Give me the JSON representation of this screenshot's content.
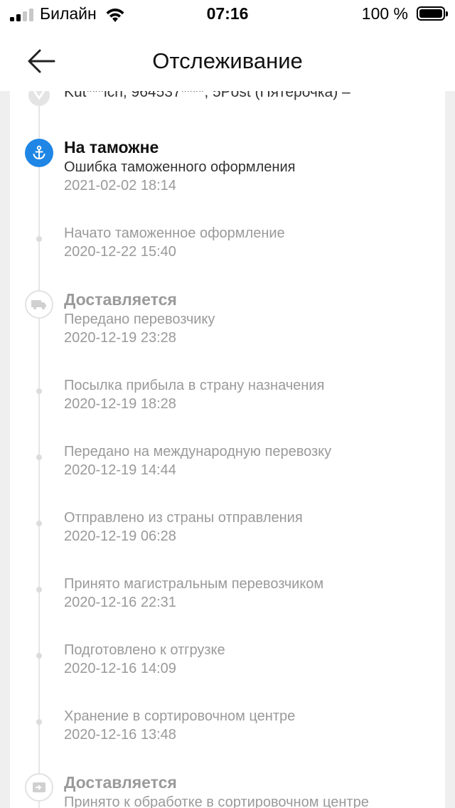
{
  "status_bar": {
    "carrier": "Билайн",
    "time": "07:16",
    "battery": "100 %"
  },
  "nav": {
    "title": "Отслеживание",
    "back_icon": "arrow-left-icon"
  },
  "address_row": {
    "text": "Kut***ich,  964537****,  5Post (Пятерочка) –",
    "icon": "location-pin-icon"
  },
  "colors": {
    "accent": "#1f86e6",
    "text_primary": "#111111",
    "text_muted": "#9a9a9a",
    "background": "#efefef"
  },
  "timeline": [
    {
      "status": "На таможне",
      "desc": "Ошибка таможенного оформления",
      "time": "2021-02-02 18:14",
      "icon": "anchor-icon"
    },
    {
      "status": "",
      "desc": "Начато таможенное оформление",
      "time": "2020-12-22 15:40",
      "icon": ""
    },
    {
      "status": "Доставляется",
      "desc": "Передано перевозчику",
      "time": "2020-12-19 23:28",
      "icon": "truck-icon"
    },
    {
      "status": "",
      "desc": "Посылка прибыла в страну назначения",
      "time": "2020-12-19 18:28",
      "icon": ""
    },
    {
      "status": "",
      "desc": "Передано на международную перевозку",
      "time": "2020-12-19 14:44",
      "icon": ""
    },
    {
      "status": "",
      "desc": "Отправлено из страны отправления",
      "time": "2020-12-19 06:28",
      "icon": ""
    },
    {
      "status": "",
      "desc": "Принято магистральным перевозчиком",
      "time": "2020-12-16 22:31",
      "icon": ""
    },
    {
      "status": "",
      "desc": "Подготовлено к отгрузке",
      "time": "2020-12-16 14:09",
      "icon": ""
    },
    {
      "status": "",
      "desc": "Хранение в сортировочном центре",
      "time": "2020-12-16 13:48",
      "icon": ""
    },
    {
      "status": "Доставляется",
      "desc": "Принято к обработке в сортировочном центре",
      "time": "",
      "icon": "sorting-center-icon"
    }
  ]
}
